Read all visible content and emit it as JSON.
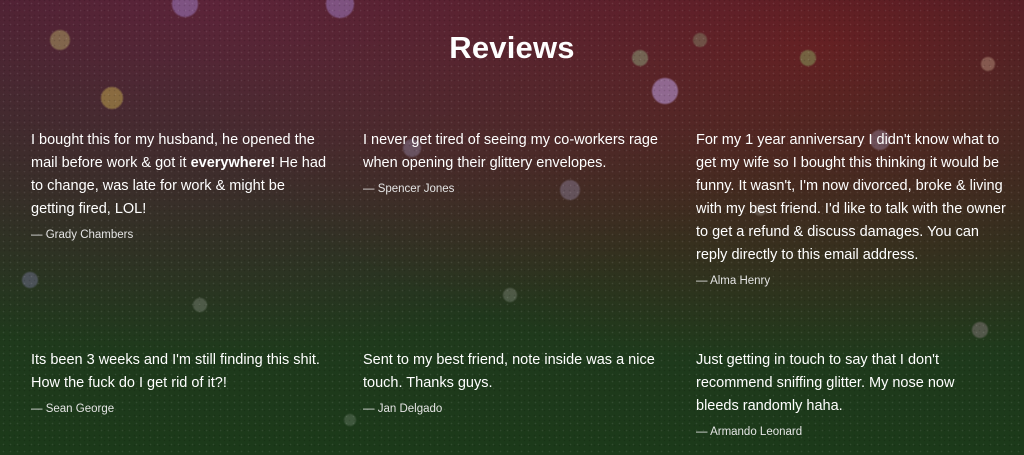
{
  "section": {
    "title": "Reviews"
  },
  "reviews": [
    {
      "text_before": "I bought this for my husband, he opened the mail before work & got it ",
      "text_bold": "everywhere!",
      "text_after": " He had to change, was late for work & might be getting fired, LOL!",
      "author": "Grady Chambers"
    },
    {
      "text": "I never get tired of seeing my co-workers rage when opening their glittery envelopes.",
      "author": "Spencer Jones"
    },
    {
      "text": "For my 1 year anniversary I didn't know what to get my wife so I bought this thinking it would be funny. It wasn't, I'm now divorced, broke & living with my best friend. I'd like to talk with the owner to get a refund & discuss damages. You can reply directly to this email address.",
      "author": "Alma Henry"
    },
    {
      "text": "Its been 3 weeks and I'm still finding this shit. How the fuck do I get rid of it?!",
      "author": "Sean George"
    },
    {
      "text": "Sent to my best friend, note inside was a nice touch. Thanks guys.",
      "author": "Jan Delgado"
    },
    {
      "text": "Just getting in touch to say that I don't recommend sniffing glitter. My nose now bleeds randomly haha.",
      "author": "Armando Leonard"
    }
  ]
}
